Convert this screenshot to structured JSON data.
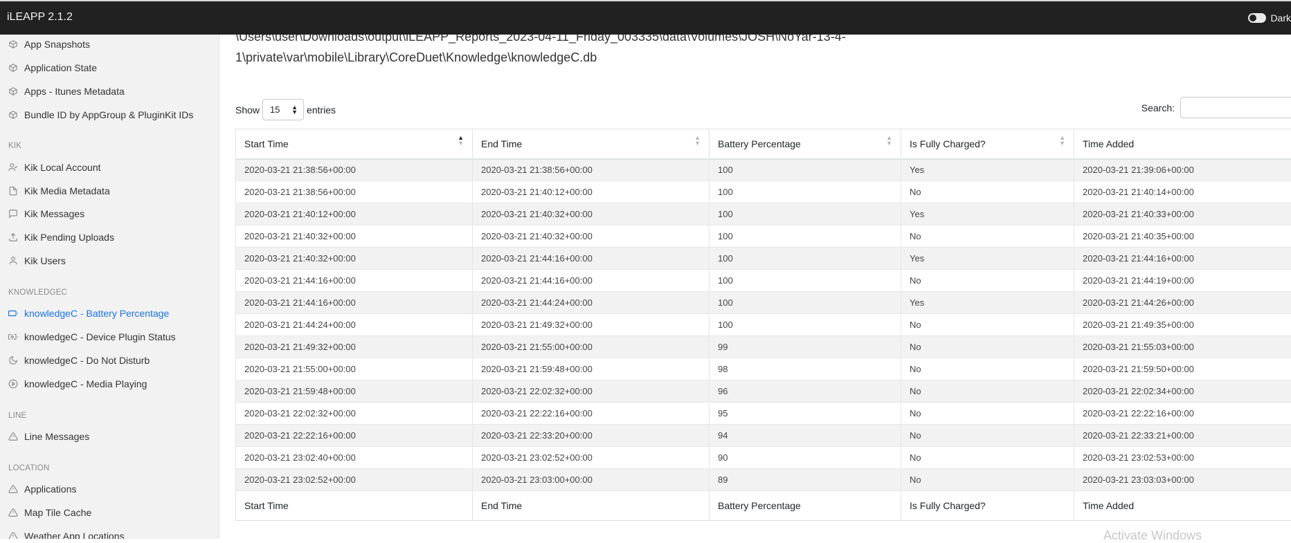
{
  "app": {
    "title": "iLEAPP 2.1.2",
    "dark_label": "Dark"
  },
  "sidebar": {
    "items_top": [
      {
        "label": "App Snapshots",
        "icon": "package-icon"
      },
      {
        "label": "Application State",
        "icon": "package-icon"
      },
      {
        "label": "Apps - Itunes Metadata",
        "icon": "package-icon"
      },
      {
        "label": "Bundle ID by AppGroup & PluginKit IDs",
        "icon": "package-icon"
      }
    ],
    "kik": {
      "heading": "KIK",
      "items": [
        {
          "label": "Kik Local Account",
          "icon": "user-check-icon"
        },
        {
          "label": "Kik Media Metadata",
          "icon": "file-icon"
        },
        {
          "label": "Kik Messages",
          "icon": "message-square-icon"
        },
        {
          "label": "Kik Pending Uploads",
          "icon": "upload-icon"
        },
        {
          "label": "Kik Users",
          "icon": "user-icon"
        }
      ]
    },
    "knowledgec": {
      "heading": "KNOWLEDGEC",
      "items": [
        {
          "label": "knowledgeC - Battery Percentage",
          "icon": "battery-icon"
        },
        {
          "label": "knowledgeC - Device Plugin Status",
          "icon": "battery-charging-icon"
        },
        {
          "label": "knowledgeC - Do Not Disturb",
          "icon": "moon-icon"
        },
        {
          "label": "knowledgeC - Media Playing",
          "icon": "play-circle-icon"
        }
      ]
    },
    "line": {
      "heading": "LINE",
      "items": [
        {
          "label": "Line Messages",
          "icon": "alert-triangle-icon"
        }
      ]
    },
    "location": {
      "heading": "LOCATION",
      "items": [
        {
          "label": "Applications",
          "icon": "alert-triangle-icon"
        },
        {
          "label": "Map Tile Cache",
          "icon": "alert-triangle-icon"
        },
        {
          "label": "Weather App Locations",
          "icon": "alert-triangle-icon"
        }
      ]
    }
  },
  "main": {
    "path_line1": "\\Users\\user\\Downloads\\output\\iLEAPP_Reports_2023-04-11_Friday_003335\\data\\Volumes\\JOSH\\NoYar-13-4-",
    "path_line2": "1\\private\\var\\mobile\\Library\\CoreDuet\\Knowledge\\knowledgeC.db",
    "show_label": "Show",
    "entries_value": "15",
    "entries_label": "entries",
    "search_label": "Search:"
  },
  "table": {
    "columns": [
      "Start Time",
      "End Time",
      "Battery Percentage",
      "Is Fully Charged?",
      "Time Added"
    ],
    "rows": [
      [
        "2020-03-21 21:38:56+00:00",
        "2020-03-21 21:38:56+00:00",
        "100",
        "Yes",
        "2020-03-21 21:39:06+00:00"
      ],
      [
        "2020-03-21 21:38:56+00:00",
        "2020-03-21 21:40:12+00:00",
        "100",
        "No",
        "2020-03-21 21:40:14+00:00"
      ],
      [
        "2020-03-21 21:40:12+00:00",
        "2020-03-21 21:40:32+00:00",
        "100",
        "Yes",
        "2020-03-21 21:40:33+00:00"
      ],
      [
        "2020-03-21 21:40:32+00:00",
        "2020-03-21 21:40:32+00:00",
        "100",
        "No",
        "2020-03-21 21:40:35+00:00"
      ],
      [
        "2020-03-21 21:40:32+00:00",
        "2020-03-21 21:44:16+00:00",
        "100",
        "Yes",
        "2020-03-21 21:44:16+00:00"
      ],
      [
        "2020-03-21 21:44:16+00:00",
        "2020-03-21 21:44:16+00:00",
        "100",
        "No",
        "2020-03-21 21:44:19+00:00"
      ],
      [
        "2020-03-21 21:44:16+00:00",
        "2020-03-21 21:44:24+00:00",
        "100",
        "Yes",
        "2020-03-21 21:44:26+00:00"
      ],
      [
        "2020-03-21 21:44:24+00:00",
        "2020-03-21 21:49:32+00:00",
        "100",
        "No",
        "2020-03-21 21:49:35+00:00"
      ],
      [
        "2020-03-21 21:49:32+00:00",
        "2020-03-21 21:55:00+00:00",
        "99",
        "No",
        "2020-03-21 21:55:03+00:00"
      ],
      [
        "2020-03-21 21:55:00+00:00",
        "2020-03-21 21:59:48+00:00",
        "98",
        "No",
        "2020-03-21 21:59:50+00:00"
      ],
      [
        "2020-03-21 21:59:48+00:00",
        "2020-03-21 22:02:32+00:00",
        "96",
        "No",
        "2020-03-21 22:02:34+00:00"
      ],
      [
        "2020-03-21 22:02:32+00:00",
        "2020-03-21 22:22:16+00:00",
        "95",
        "No",
        "2020-03-21 22:22:16+00:00"
      ],
      [
        "2020-03-21 22:22:16+00:00",
        "2020-03-21 22:33:20+00:00",
        "94",
        "No",
        "2020-03-21 22:33:21+00:00"
      ],
      [
        "2020-03-21 23:02:40+00:00",
        "2020-03-21 23:02:52+00:00",
        "90",
        "No",
        "2020-03-21 23:02:53+00:00"
      ],
      [
        "2020-03-21 23:02:52+00:00",
        "2020-03-21 23:03:00+00:00",
        "89",
        "No",
        "2020-03-21 23:03:03+00:00"
      ]
    ]
  },
  "watermark": "Activate Windows"
}
